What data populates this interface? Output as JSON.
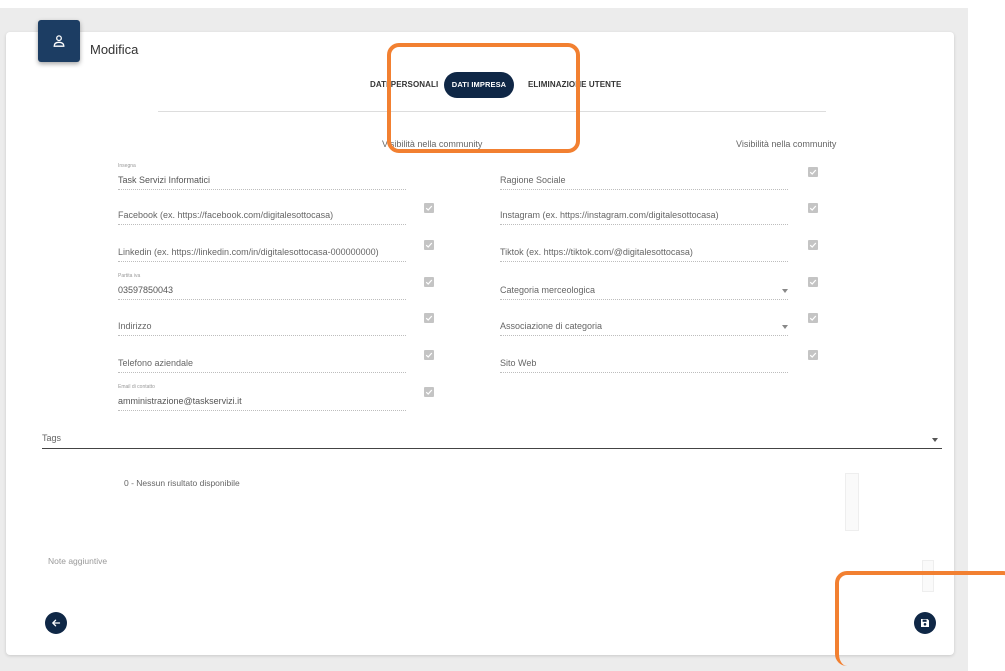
{
  "header": {
    "title": "Modifica",
    "icon": "user-icon"
  },
  "tabs": [
    {
      "label": "DATI PERSONALI",
      "active": false
    },
    {
      "label": "DATI IMPRESA",
      "active": true
    },
    {
      "label": "ELIMINAZIONE UTENTE",
      "active": false
    }
  ],
  "visibility": {
    "left_header": "Visibilità nella community",
    "right_header": "Visibilità nella community"
  },
  "left_fields": [
    {
      "label": "Insegna",
      "value": "Task Servizi Informatici",
      "checkbox": false
    },
    {
      "label": "",
      "value": "Facebook (ex. https://facebook.com/digitalesottocasa)",
      "checkbox": true
    },
    {
      "label": "",
      "value": "Linkedin (ex. https://linkedin.com/in/digitalesottocasa-000000000)",
      "checkbox": true
    },
    {
      "label": "Partita iva",
      "value": "03597850043",
      "checkbox": true
    },
    {
      "label": "",
      "value": "Indirizzo",
      "checkbox": true
    },
    {
      "label": "",
      "value": "Telefono aziendale",
      "checkbox": true
    },
    {
      "label": "Email di contatto",
      "value": "amministrazione@taskservizi.it",
      "checkbox": true
    }
  ],
  "right_fields": [
    {
      "value": "Ragione Sociale",
      "dropdown": false
    },
    {
      "value": "Instagram (ex. https://instagram.com/digitalesottocasa)",
      "dropdown": false
    },
    {
      "value": "Tiktok (ex. https://tiktok.com/@digitalesottocasa)",
      "dropdown": false
    },
    {
      "value": "Categoria merceologica",
      "dropdown": true
    },
    {
      "value": "Associazione di categoria",
      "dropdown": true
    },
    {
      "value": "Sito Web",
      "dropdown": false
    }
  ],
  "tags": {
    "label": "Tags",
    "no_results": "0 - Nessun risultato disponibile"
  },
  "notes": {
    "label": "Note aggiuntive"
  },
  "actions": {
    "back_icon": "arrow-left-icon",
    "save_icon": "save-icon"
  },
  "colors": {
    "primary": "#0f2746",
    "annotation": "#f28031",
    "checkbox": "#c4c4c4"
  }
}
